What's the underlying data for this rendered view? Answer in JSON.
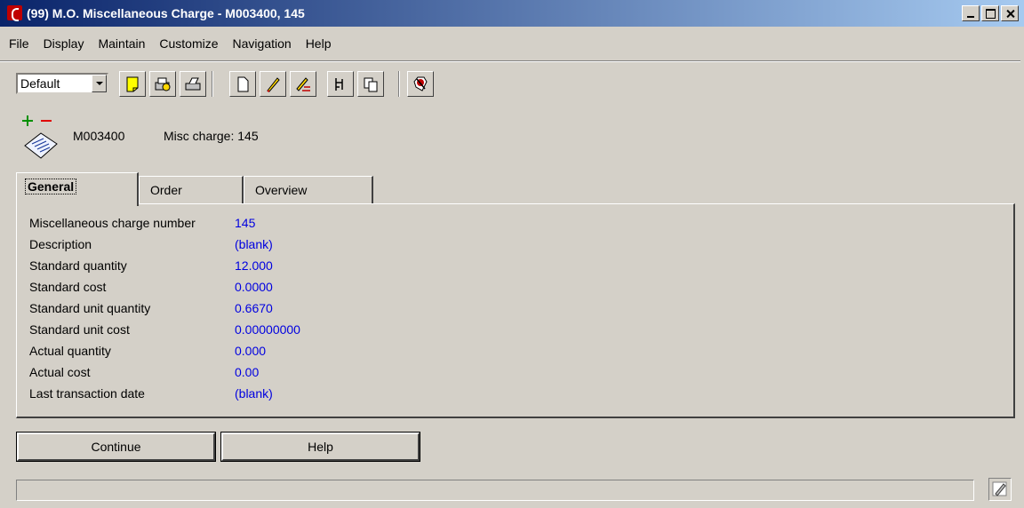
{
  "window": {
    "title": "(99) M.O. Miscellaneous Charge - M003400, 145"
  },
  "menu": {
    "items": [
      "File",
      "Display",
      "Maintain",
      "Customize",
      "Navigation",
      "Help"
    ]
  },
  "toolbar": {
    "view_select": "Default",
    "icons": [
      "note-icon",
      "print-preview-icon",
      "print-icon",
      "new-document-icon",
      "edit-pencil-icon",
      "edit-lines-icon",
      "tree-icon",
      "copy-icon",
      "exit-icon"
    ]
  },
  "header": {
    "item_id": "M003400",
    "misc_charge": "Misc charge: 145"
  },
  "tabs": [
    {
      "label": "General",
      "active": true
    },
    {
      "label": "Order",
      "active": false
    },
    {
      "label": "Overview",
      "active": false
    }
  ],
  "fields": [
    {
      "label": "Miscellaneous charge number",
      "value": "145"
    },
    {
      "label": "Description",
      "value": "(blank)"
    },
    {
      "label": "Standard quantity",
      "value": "12.000"
    },
    {
      "label": "Standard cost",
      "value": "0.0000"
    },
    {
      "label": "Standard unit quantity",
      "value": "0.6670"
    },
    {
      "label": "Standard unit cost",
      "value": "0.00000000"
    },
    {
      "label": "Actual quantity",
      "value": "0.000"
    },
    {
      "label": "Actual cost",
      "value": "0.00"
    },
    {
      "label": "Last transaction date",
      "value": "(blank)"
    }
  ],
  "buttons": {
    "continue": "Continue",
    "help": "Help"
  },
  "colors": {
    "value_text": "#0000e0",
    "title_start": "#0a246a",
    "title_end": "#a6caf0",
    "window_bg": "#d4d0c8"
  }
}
